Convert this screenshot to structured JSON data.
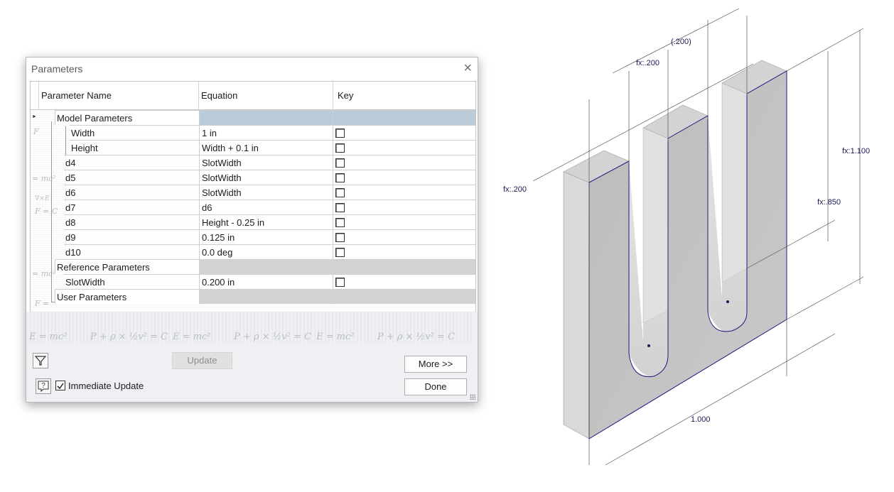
{
  "dialog": {
    "title": "Parameters",
    "close_glyph": "×",
    "columns": {
      "name": "Parameter Name",
      "equation": "Equation",
      "key": "Key"
    },
    "groups": {
      "model": "Model Parameters",
      "reference": "Reference Parameters",
      "user": "User Parameters"
    },
    "model_params": [
      {
        "name": "Width",
        "equation": "1 in",
        "key": false
      },
      {
        "name": "Height",
        "equation": "Width + 0.1 in",
        "key": false
      },
      {
        "name": "d4",
        "equation": "SlotWidth",
        "key": false
      },
      {
        "name": "d5",
        "equation": "SlotWidth",
        "key": false
      },
      {
        "name": "d6",
        "equation": "SlotWidth",
        "key": false
      },
      {
        "name": "d7",
        "equation": "d6",
        "key": false
      },
      {
        "name": "d8",
        "equation": "Height - 0.25 in",
        "key": false
      },
      {
        "name": "d9",
        "equation": "0.125 in",
        "key": false
      },
      {
        "name": "d10",
        "equation": "0.0 deg",
        "key": false
      }
    ],
    "reference_params": [
      {
        "name": "SlotWidth",
        "equation": "0.200 in",
        "key": false
      }
    ],
    "buttons": {
      "update": "Update",
      "more": "More >>",
      "done": "Done"
    },
    "immediate_update_label": "Immediate Update",
    "immediate_update_checked": true,
    "icons": {
      "filter": "filter-icon",
      "help": "help-icon"
    }
  },
  "cad": {
    "dims": {
      "slot_top_a": "fx:.200",
      "slot_top_b": "(.200)",
      "left_depth": "fx:.200",
      "height": "fx:1.100",
      "slot_depth": "fx:.850",
      "width": "1.000"
    }
  },
  "colors": {
    "group_header_active": "#bccbd9",
    "group_header": "#d3d3d3",
    "edge_line": "#1a1a80"
  }
}
